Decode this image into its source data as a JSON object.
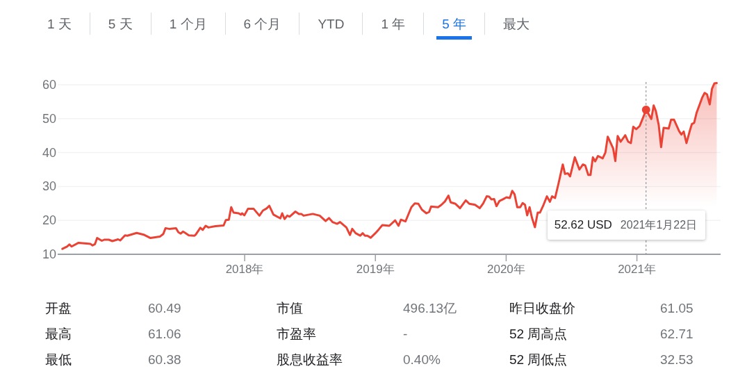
{
  "tabs": [
    {
      "label": "1 天",
      "selected": false
    },
    {
      "label": "5 天",
      "selected": false
    },
    {
      "label": "1 个月",
      "selected": false
    },
    {
      "label": "6 个月",
      "selected": false
    },
    {
      "label": "YTD",
      "selected": false
    },
    {
      "label": "1 年",
      "selected": false
    },
    {
      "label": "5 年",
      "selected": true
    },
    {
      "label": "最大",
      "selected": false
    }
  ],
  "chart": {
    "chart_data": {
      "type": "area",
      "grid": true,
      "x": [
        2016.606,
        2016.642,
        2016.66,
        2016.677,
        2016.73,
        2016.819,
        2016.837,
        2016.855,
        2016.872,
        2016.908,
        2016.926,
        2016.961,
        2016.988,
        2017.032,
        2017.049,
        2017.085,
        2017.103,
        2017.174,
        2017.227,
        2017.28,
        2017.351,
        2017.378,
        2017.395,
        2017.422,
        2017.475,
        2017.493,
        2017.511,
        2017.528,
        2017.546,
        2017.573,
        2017.617,
        2017.626,
        2017.661,
        2017.679,
        2017.702,
        2017.723,
        2017.777,
        2017.839,
        2017.856,
        2017.879,
        2017.897,
        2017.915,
        2017.954,
        2017.972,
        2017.98,
        2017.998,
        2018.025,
        2018.069,
        2018.113,
        2018.14,
        2018.167,
        2018.188,
        2018.22,
        2018.273,
        2018.287,
        2018.305,
        2018.326,
        2018.344,
        2018.388,
        2018.415,
        2018.433,
        2018.451,
        2018.521,
        2018.574,
        2018.619,
        2018.645,
        2018.672,
        2018.707,
        2018.73,
        2018.778,
        2018.805,
        2018.823,
        2018.849,
        2018.884,
        2018.903,
        2018.92,
        2018.938,
        2018.964,
        2019.0,
        2019.027,
        2019.053,
        2019.106,
        2019.151,
        2019.177,
        2019.195,
        2019.23,
        2019.275,
        2019.301,
        2019.328,
        2019.355,
        2019.39,
        2019.411,
        2019.426,
        2019.479,
        2019.505,
        2019.532,
        2019.559,
        2019.576,
        2019.612,
        2019.647,
        2019.691,
        2019.718,
        2019.762,
        2019.798,
        2019.824,
        2019.851,
        2019.869,
        2019.887,
        2019.908,
        2019.926,
        2019.948,
        2019.975,
        2020.002,
        2020.028,
        2020.046,
        2020.064,
        2020.085,
        2020.108,
        2020.126,
        2020.144,
        2020.161,
        2020.179,
        2020.197,
        2020.22,
        2020.241,
        2020.259,
        2020.286,
        2020.312,
        2020.334,
        2020.351,
        2020.374,
        2020.401,
        2020.433,
        2020.45,
        2020.472,
        2020.489,
        2020.525,
        2020.56,
        2020.587,
        2020.605,
        2020.628,
        2020.645,
        2020.663,
        2020.681,
        2020.702,
        2020.738,
        2020.759,
        2020.777,
        2020.818,
        2020.835,
        2020.853,
        2020.876,
        2020.911,
        2020.933,
        2020.954,
        2020.972,
        2020.995,
        2021.021,
        2021.071,
        2021.11,
        2021.128,
        2021.145,
        2021.167,
        2021.185,
        2021.204,
        2021.243,
        2021.261,
        2021.284,
        2021.323,
        2021.34,
        2021.358,
        2021.379,
        2021.403,
        2021.42,
        2021.438,
        2021.456,
        2021.5,
        2021.518,
        2021.536,
        2021.557,
        2021.574,
        2021.592,
        2021.61
      ],
      "series": [
        {
          "color": "#ea4335",
          "values": [
            11.6,
            12.3,
            12.9,
            12.3,
            13.4,
            13.1,
            12.6,
            13.0,
            14.8,
            14.0,
            14.3,
            14.3,
            13.9,
            14.4,
            14.1,
            15.6,
            15.5,
            16.3,
            15.8,
            14.8,
            15.2,
            16.0,
            17.7,
            17.5,
            17.7,
            16.5,
            16.1,
            16.7,
            16.3,
            15.6,
            15.5,
            15.8,
            17.8,
            17.2,
            18.4,
            17.9,
            18.3,
            18.5,
            20.1,
            20.2,
            23.9,
            22.3,
            22.1,
            21.7,
            22.1,
            21.5,
            23.4,
            23.4,
            21.4,
            22.9,
            23.5,
            24.3,
            21.7,
            20.6,
            22.1,
            20.4,
            21.4,
            21.1,
            22.6,
            21.9,
            21.9,
            21.4,
            21.9,
            21.4,
            19.8,
            20.7,
            19.5,
            19.0,
            19.5,
            17.9,
            15.7,
            17.5,
            16.2,
            15.5,
            16.2,
            15.5,
            15.5,
            14.9,
            16.2,
            17.4,
            18.6,
            18.4,
            20.0,
            18.4,
            20.2,
            19.7,
            23.9,
            25.0,
            24.9,
            23.2,
            22.1,
            22.5,
            24.1,
            23.9,
            24.6,
            25.6,
            27.3,
            25.3,
            24.9,
            23.6,
            25.9,
            24.9,
            24.6,
            23.6,
            25.0,
            27.1,
            27.0,
            26.2,
            26.3,
            24.2,
            25.7,
            26.2,
            26.8,
            26.6,
            28.7,
            27.7,
            23.9,
            23.9,
            25.1,
            24.6,
            21.5,
            23.9,
            20.8,
            18.0,
            22.3,
            22.3,
            24.6,
            27.1,
            25.5,
            27.1,
            26.6,
            31.0,
            36.5,
            33.7,
            33.9,
            33.0,
            38.6,
            35.0,
            36.5,
            36.2,
            33.4,
            33.4,
            38.6,
            37.4,
            39.0,
            38.3,
            40.0,
            44.7,
            41.3,
            37.5,
            44.9,
            43.2,
            45.1,
            43.2,
            42.8,
            47.6,
            46.9,
            47.8,
            52.6,
            49.9,
            53.9,
            52.2,
            48.1,
            41.6,
            47.3,
            47.1,
            49.7,
            49.7,
            46.3,
            45.3,
            46.2,
            42.8,
            46.2,
            48.4,
            48.8,
            51.7,
            56.3,
            57.6,
            57.2,
            54.2,
            58.8,
            60.4,
            60.5
          ]
        }
      ],
      "xlim": [
        2016.57,
        2021.64
      ],
      "ylim": [
        10,
        61
      ],
      "xticks": [
        {
          "value": 2018,
          "label": "2018年"
        },
        {
          "value": 2019,
          "label": "2019年"
        },
        {
          "value": 2020,
          "label": "2020年"
        },
        {
          "value": 2021,
          "label": "2021年"
        }
      ],
      "yticks": [
        10,
        20,
        30,
        40,
        50,
        60
      ],
      "ref_lines": [
        {
          "axis": "x",
          "value": 2021.07,
          "color": "#80868b"
        }
      ]
    },
    "tooltip": {
      "value": "52.62 USD",
      "date": "2021年1月22日"
    }
  },
  "stats": [
    {
      "label": "开盘",
      "value": "60.49"
    },
    {
      "label": "市值",
      "value": "496.13亿"
    },
    {
      "label": "昨日收盘价",
      "value": "61.05"
    },
    {
      "label": "最高",
      "value": "61.06"
    },
    {
      "label": "市盈率",
      "value": "-"
    },
    {
      "label": "52 周高点",
      "value": "62.71"
    },
    {
      "label": "最低",
      "value": "60.38"
    },
    {
      "label": "股息收益率",
      "value": "0.40%"
    },
    {
      "label": "52 周低点",
      "value": "32.53"
    }
  ]
}
